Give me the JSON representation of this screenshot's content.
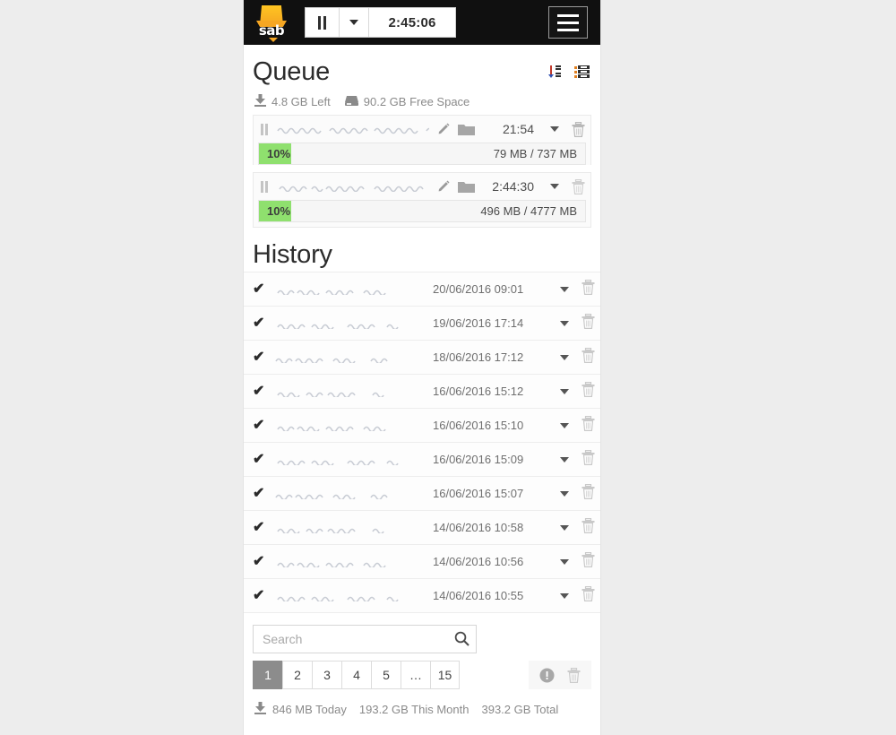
{
  "brand": {
    "logo_text": "sab",
    "accent": "#f5a623",
    "topbar_bg": "#101010"
  },
  "topbar": {
    "pause_icon": "pause-icon",
    "pause_dropdown_icon": "chevron-down-icon",
    "time_remaining": "2:45:06",
    "menu_icon": "hamburger-menu-icon"
  },
  "queue": {
    "title": "Queue",
    "sort_icon": "sort-alpha-desc-icon",
    "options_icon": "queue-options-icon",
    "meta": {
      "left_icon": "download-icon",
      "left_label": "4.8 GB Left",
      "disk_icon": "hard-drive-icon",
      "disk_label": "90.2 GB Free Space"
    },
    "row_icons": {
      "pause": "pause-icon",
      "edit": "pencil-icon",
      "folder": "folder-icon",
      "dropdown": "caret-down-icon",
      "delete": "trash-icon"
    },
    "progress_color": "#8fe06e",
    "items": [
      {
        "name_redacted": true,
        "eta": "21:54",
        "percent": "10%",
        "percent_value": 10,
        "size": "79 MB / 737 MB"
      },
      {
        "name_redacted": true,
        "eta": "2:44:30",
        "percent": "10%",
        "percent_value": 10,
        "size": "496 MB / 4777 MB"
      }
    ]
  },
  "history": {
    "title": "History",
    "row_icons": {
      "status": "check-icon",
      "dropdown": "caret-down-icon",
      "delete": "trash-icon"
    },
    "items": [
      {
        "status": "✔",
        "date": "20/06/2016 09:01"
      },
      {
        "status": "✔",
        "date": "19/06/2016 17:14"
      },
      {
        "status": "✔",
        "date": "18/06/2016 17:12"
      },
      {
        "status": "✔",
        "date": "16/06/2016 15:12"
      },
      {
        "status": "✔",
        "date": "16/06/2016 15:10"
      },
      {
        "status": "✔",
        "date": "16/06/2016 15:09"
      },
      {
        "status": "✔",
        "date": "16/06/2016 15:07"
      },
      {
        "status": "✔",
        "date": "14/06/2016 10:58"
      },
      {
        "status": "✔",
        "date": "14/06/2016 10:56"
      },
      {
        "status": "✔",
        "date": "14/06/2016 10:55"
      }
    ],
    "search": {
      "value": "",
      "placeholder": "Search",
      "icon": "search-icon"
    },
    "pagination": {
      "pages": [
        "1",
        "2",
        "3",
        "4",
        "5",
        "…",
        "15"
      ],
      "active": "1",
      "active_bg": "#8c8c8c"
    },
    "actions": {
      "retry_failed_icon": "exclamation-circle-icon",
      "purge_icon": "trash-icon"
    },
    "stats": {
      "icon": "download-icon",
      "today": "846 MB Today",
      "month": "193.2 GB This Month",
      "total": "393.2 GB Total"
    }
  }
}
